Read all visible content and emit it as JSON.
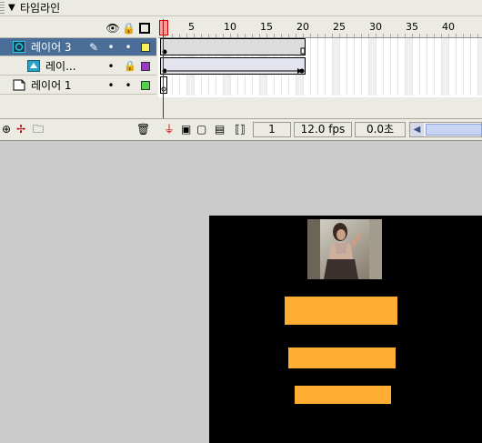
{
  "timeline": {
    "title": "타임라인",
    "ruler_labels": [
      "1",
      "5",
      "10",
      "15",
      "20",
      "25",
      "30",
      "35",
      "40"
    ],
    "layers": [
      {
        "name": "레이어 3",
        "selected": true,
        "icon": "layer-icon-movieclip",
        "color": "#f7f25b"
      },
      {
        "name": "레이...",
        "selected": false,
        "icon": "mask-layer-icon",
        "color": "#9b37c9"
      },
      {
        "name": "레이어 1",
        "selected": false,
        "icon": "guide-layer-icon",
        "color": "#4cd44c"
      }
    ],
    "status": {
      "current_frame": "1",
      "frame_rate": "12.0 fps",
      "elapsed": "0.0초"
    }
  },
  "stage": {
    "background": "#000000",
    "bar_color": "#ffad33",
    "photo": "photo-thumbnail"
  },
  "colors": {
    "selected_row": "#4a6e97",
    "panel_bg": "#ecebe3",
    "workspace": "#cbcbcb",
    "playhead": "#d20000"
  }
}
